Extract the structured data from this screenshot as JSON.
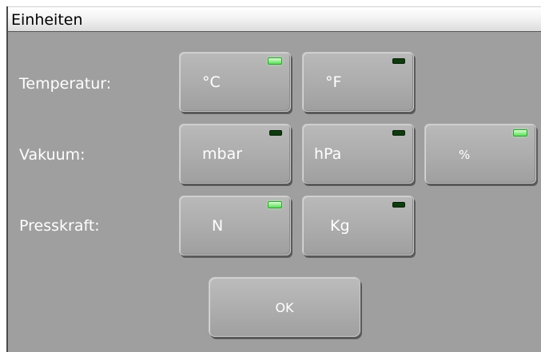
{
  "window": {
    "title": "Einheiten"
  },
  "rows": [
    {
      "label": "Temperatur:",
      "buttons": [
        {
          "label": "°C",
          "selected": true
        },
        {
          "label": "°F",
          "selected": false
        }
      ]
    },
    {
      "label": "Vakuum:",
      "buttons": [
        {
          "label": "mbar",
          "selected": false
        },
        {
          "label": "hPa",
          "selected": false
        },
        {
          "label": "%",
          "selected": true
        }
      ]
    },
    {
      "label": "Presskraft:",
      "buttons": [
        {
          "label": "N",
          "selected": true
        },
        {
          "label": "Kg",
          "selected": false
        }
      ]
    }
  ],
  "ok_label": "OK",
  "colors": {
    "panel": "#9f9f9f",
    "led_on": "#5ce05a",
    "led_off": "#0e3c0e"
  }
}
